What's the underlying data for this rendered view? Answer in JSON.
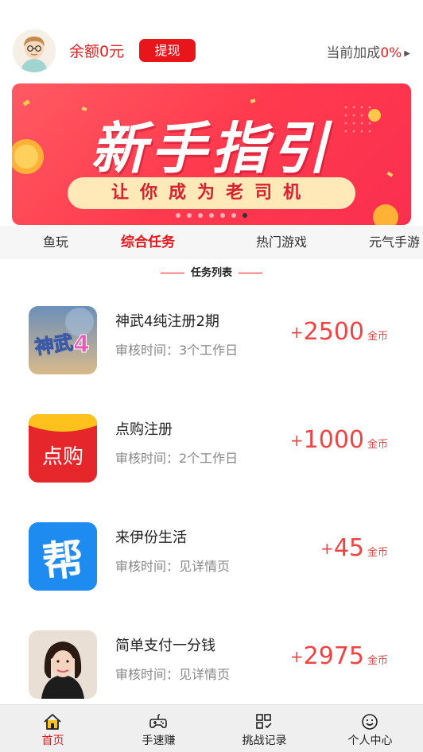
{
  "header": {
    "balance": "余额0元",
    "withdraw_label": "提现",
    "bonus_label": "当前加成",
    "bonus_value": "0%",
    "bonus_arrow": "▶"
  },
  "banner": {
    "title": "新手指引",
    "subtitle": "让你成为老司机",
    "slide_count": 7,
    "active_slide": 7,
    "background_color": "#ff4254",
    "pill_color": "#ffe9b8"
  },
  "tabs": [
    {
      "label": "鱼玩",
      "active": false
    },
    {
      "label": "综合任务",
      "active": true
    },
    {
      "label": "热门游戏",
      "active": false
    },
    {
      "label": "元气手游",
      "active": false
    }
  ],
  "section": {
    "title": "任务列表"
  },
  "tasks": [
    {
      "name": "神武4纯注册2期",
      "review_time": "审核时间：3个工作日",
      "plus": "+",
      "amount": "2500",
      "unit": "金币",
      "icon": "shenwu4-game-icon"
    },
    {
      "name": "点购注册",
      "review_time": "审核时间：2个工作日",
      "plus": "+",
      "amount": "1000",
      "unit": "金币",
      "icon": "diangou-app-icon",
      "icon_text": "点购"
    },
    {
      "name": "来伊份生活",
      "review_time": "审核时间：见详情页",
      "plus": "+",
      "amount": "45",
      "unit": "金币",
      "icon": "laiyifen-app-icon",
      "icon_text": "帮"
    },
    {
      "name": "简单支付一分钱",
      "review_time": "审核时间：见详情页",
      "plus": "+",
      "amount": "2975",
      "unit": "金币",
      "icon": "portrait-app-icon"
    }
  ],
  "bottom_nav": [
    {
      "label": "首页",
      "icon": "home-icon",
      "active": true
    },
    {
      "label": "手速赚",
      "icon": "gamepad-icon",
      "active": false
    },
    {
      "label": "挑战记录",
      "icon": "records-icon",
      "active": false
    },
    {
      "label": "个人中心",
      "icon": "smiley-icon",
      "active": false
    }
  ],
  "colors": {
    "accent": "#e8151b",
    "reward": "#ee4444",
    "tab_bar_bg": "#f6f6f6",
    "nav_bg": "#efefef"
  }
}
